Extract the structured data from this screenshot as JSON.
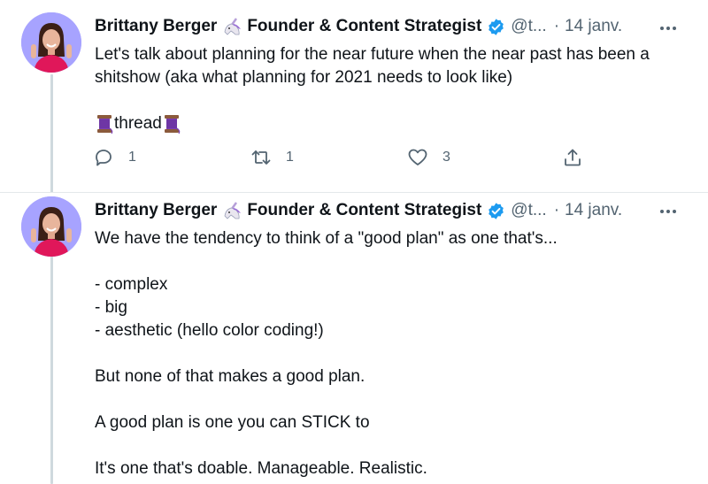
{
  "tweets": [
    {
      "author": "Brittany Berger",
      "title": "Founder & Content Strategist",
      "handle": "@t...",
      "separator": "·",
      "date": "14 janv.",
      "text_lines": [
        "Let's talk about planning for the near future when the near past has been a",
        "shitshow (aka what planning for 2021 needs to look like)"
      ],
      "thread_label": "thread",
      "replies": "1",
      "retweets": "1",
      "likes": "3"
    },
    {
      "author": "Brittany Berger",
      "title": "Founder & Content Strategist",
      "handle": "@t...",
      "separator": "·",
      "date": "14 janv.",
      "text_lines": [
        "We have the tendency to think of a \"good plan\" as one that's...",
        "",
        "- complex",
        "- big",
        "- aesthetic (hello color coding!)",
        "",
        "But none of that makes a good plan.",
        "",
        "A good plan is one you can STICK to",
        "",
        "It's one that's doable. Manageable. Realistic."
      ]
    }
  ],
  "icons": {
    "unicorn": "unicorn-icon",
    "verified": "verified-badge-icon",
    "more": "more-icon",
    "spool": "spool-of-thread-icon",
    "reply": "reply-icon",
    "retweet": "retweet-icon",
    "like": "heart-icon",
    "share": "share-icon"
  },
  "colors": {
    "verified": "#1d9bf0",
    "secondary_text": "#536471",
    "thread_line": "#cfd9de"
  }
}
